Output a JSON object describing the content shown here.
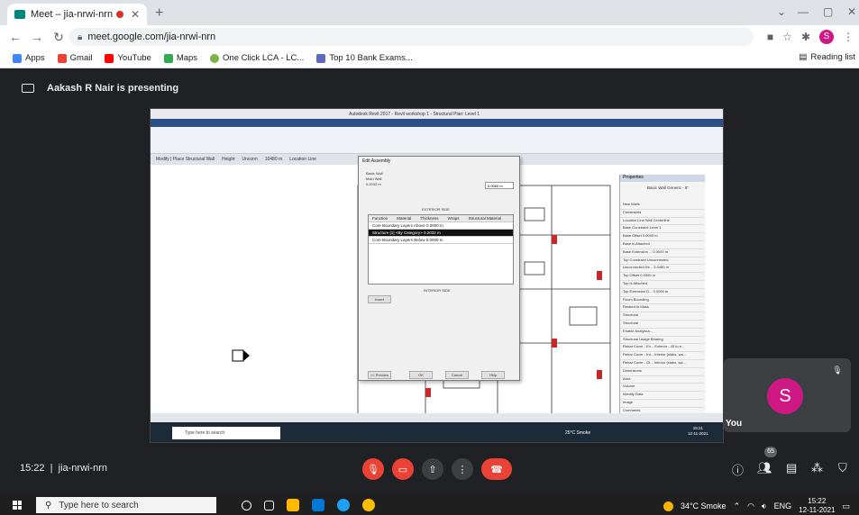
{
  "browser": {
    "tab_title": "Meet – jia-nrwi-nrn",
    "new_tab": "+",
    "url": "meet.google.com/jia-nrwi-nrn",
    "profile_initial": "S"
  },
  "bookmarks": [
    {
      "label": "Apps",
      "color": "#4285f4"
    },
    {
      "label": "Gmail",
      "color": "#ea4335"
    },
    {
      "label": "YouTube",
      "color": "#ff0000"
    },
    {
      "label": "Maps",
      "color": "#34a853"
    },
    {
      "label": "One Click LCA - LC...",
      "color": "#7cb342"
    },
    {
      "label": "Top 10 Bank Exams...",
      "color": "#5c6bc0"
    }
  ],
  "reading_list": "Reading list",
  "meet": {
    "presenter_banner": "Aakash R Nair is presenting",
    "time": "15:22",
    "meeting_code": "jia-nrwi-nrn",
    "participant_count": "65",
    "self_label": "You",
    "self_initial": "S"
  },
  "shared_screen": {
    "revit_title": "Autodesk Revit 2017 -   Revit workshop 1 - Structural Plan: Level 1",
    "options_bar": [
      "Modify | Place Structural Wall",
      "Height",
      "Unconn",
      "10480 m",
      "Location Line"
    ],
    "dialog": {
      "title": "Edit Assembly",
      "family": "Basic Wall",
      "type": "Main Wall",
      "total_thickness": "0.2032 m",
      "sample_height": "6.0960 m",
      "section": "EXTERIOR SIDE",
      "columns": [
        "Function",
        "Material",
        "Thickness",
        "Wraps",
        "Structural Material"
      ],
      "rows": [
        "Core Boundary  Layers Above  0.0000 m",
        "Structure [1]  <By Category>  0.2032 m",
        "Core Boundary  Layers Below  0.0000 m"
      ],
      "interior_side": "INTERIOR SIDE",
      "buttons": [
        "Insert",
        "<< Preview",
        "OK",
        "Cancel",
        "Help"
      ]
    },
    "properties": {
      "header": "Properties",
      "type_name": "Basic Wall Generic - 8\"",
      "rows": [
        "New Walls",
        "Constraints",
        "Location Line     Wall Centerline",
        "Base Constraint    Level 1",
        "Base Offset       0.0000 m",
        "Base is Attached",
        "Base Extension ...  0.0000 m",
        "Top Constraint    Unconnected",
        "Unconnected He...  3.0480 m",
        "Top Offset        0.0000 m",
        "Top is Attached",
        "Top Extension D...  0.0000 m",
        "Room Bounding",
        "Related to Mass",
        "Structural",
        "Structural",
        "Enable Analytica...",
        "Structural Usage    Bearing",
        "Rebar Cover - Ex...  Exterior - 40 to e...",
        "Rebar Cover - Int...  Interior (slabs, wa...",
        "Rebar Cover - Ot...  Interior (slabs, wa...",
        "Dimensions",
        "Area",
        "Volume",
        "Identity Data",
        "Image",
        "Comments",
        "Mark"
      ]
    },
    "taskbar_search": "Type here to search",
    "taskbar_weather": "25°C Smoke",
    "taskbar_time": "15:21",
    "taskbar_date": "12-11-2021"
  },
  "taskbar": {
    "search_placeholder": "Type here to search",
    "weather": "34°C Smoke",
    "language": "ENG",
    "time": "15:22",
    "date": "12-11-2021"
  }
}
